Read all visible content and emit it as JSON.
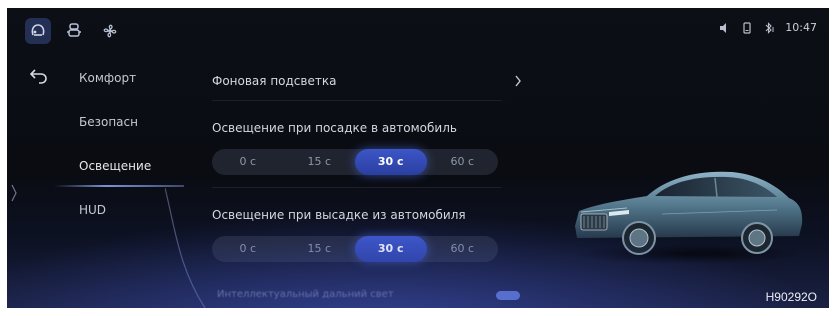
{
  "status_bar": {
    "time": "10:47"
  },
  "top_icons": [
    "headrest-icon",
    "seat-icon",
    "fan-icon"
  ],
  "sidebar": {
    "items": [
      {
        "label": "Комфорт"
      },
      {
        "label": "Безопасн"
      },
      {
        "label": "Освещение"
      },
      {
        "label": "HUD"
      }
    ],
    "selected_index": 2
  },
  "content": {
    "background_light": {
      "label": "Фоновая подсветка"
    },
    "entry_light": {
      "label": "Освещение при посадке в автомобиль",
      "options": [
        "0 с",
        "15 с",
        "30 с",
        "60 с"
      ],
      "selected": "30 с"
    },
    "exit_light": {
      "label": "Освещение при высадке из автомобиля",
      "options": [
        "0 с",
        "15 с",
        "30 с",
        "60 с"
      ],
      "selected": "30 с"
    },
    "partial_row": {
      "label": "Интеллектуальный дальний свет"
    }
  },
  "figure_code": "H90292O",
  "colors": {
    "accent": "#3c56c8",
    "background": "#0b0d13",
    "text_primary": "#d4d8e0"
  }
}
